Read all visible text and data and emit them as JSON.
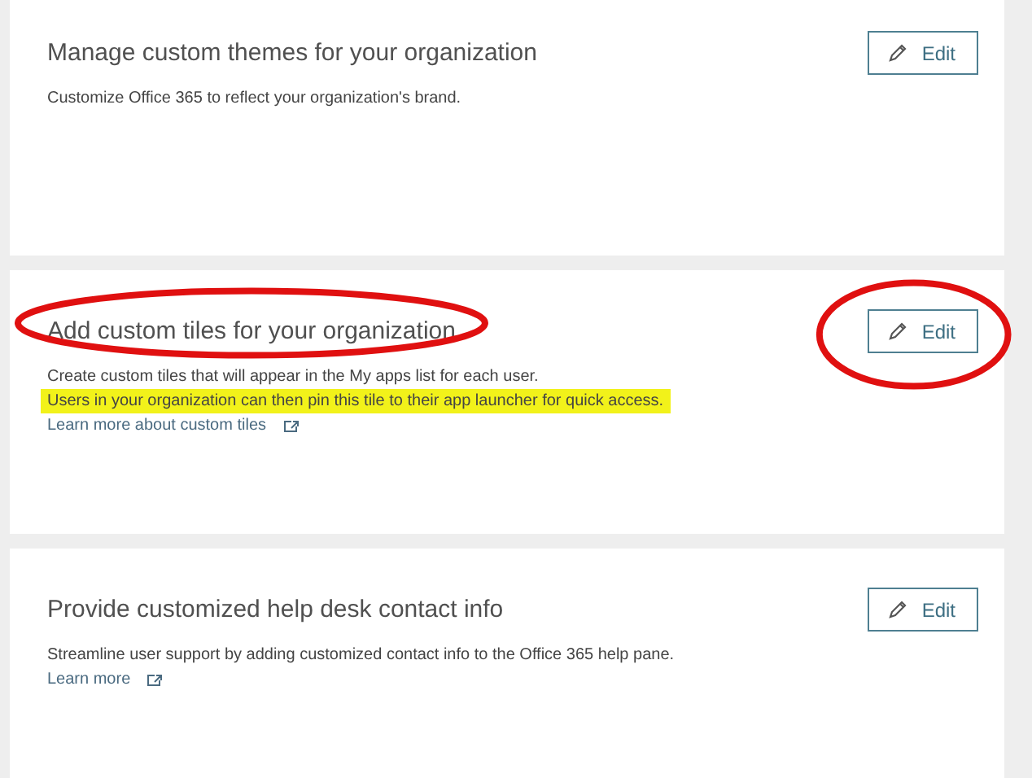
{
  "cards": [
    {
      "title": "Manage custom themes for your organization",
      "title_circled": false,
      "description": [
        {
          "text": "Customize Office 365 to reflect your organization's brand.",
          "highlighted": false
        }
      ],
      "button": {
        "label": "Edit",
        "circled": false
      }
    },
    {
      "title": "Add custom tiles for your organization",
      "title_circled": true,
      "description": [
        {
          "text": "Create custom tiles that will appear in the My apps list for each user.",
          "highlighted": false
        },
        {
          "text": "Users in your organization can then pin this tile to their app launcher for quick access.",
          "highlighted": true
        }
      ],
      "link": "Learn more about custom tiles",
      "button": {
        "label": "Edit",
        "circled": true
      }
    },
    {
      "title": "Provide customized help desk contact info",
      "title_circled": false,
      "description": [
        {
          "text": "Streamline user support by adding customized contact info to the Office 365 help pane.",
          "highlighted": false
        }
      ],
      "link": "Learn more",
      "button": {
        "label": "Edit",
        "circled": false
      }
    }
  ]
}
